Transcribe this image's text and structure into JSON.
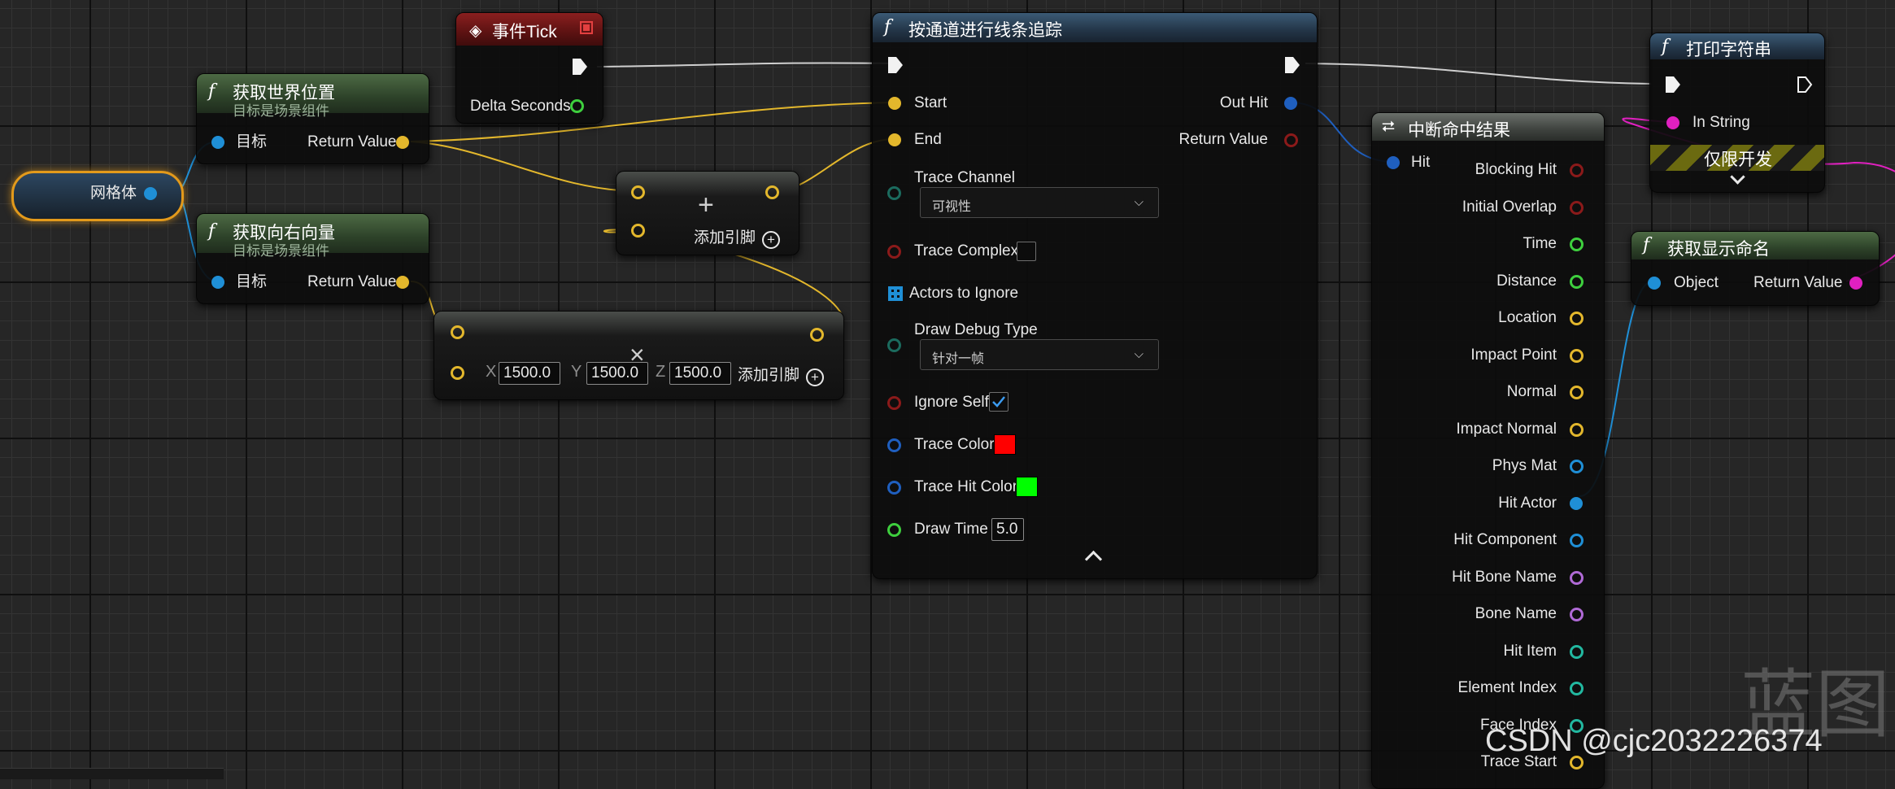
{
  "mesh_var": {
    "label": "网格体"
  },
  "event_tick": {
    "title": "事件Tick",
    "pin_delta": "Delta Seconds"
  },
  "get_world_location": {
    "title": "获取世界位置",
    "subtitle": "目标是场景组件",
    "pin_target": "目标",
    "pin_return": "Return Value"
  },
  "get_right_vector": {
    "title": "获取向右向量",
    "subtitle": "目标是场景组件",
    "pin_target": "目标",
    "pin_return": "Return Value"
  },
  "add_node": {
    "symbol": "+",
    "add_pin_label": "添加引脚"
  },
  "multiply_node": {
    "symbol": "×",
    "x_label": "X",
    "x_value": "1500.0",
    "y_label": "Y",
    "y_value": "1500.0",
    "z_label": "Z",
    "z_value": "1500.0",
    "add_pin_label": "添加引脚"
  },
  "line_trace": {
    "title": "按通道进行线条追踪",
    "pin_start": "Start",
    "pin_end": "End",
    "pin_trace_channel": "Trace Channel",
    "trace_channel_value": "可视性",
    "pin_trace_complex": "Trace Complex",
    "pin_actors_to_ignore": "Actors to Ignore",
    "pin_draw_debug_type": "Draw Debug Type",
    "draw_debug_type_value": "针对一帧",
    "pin_ignore_self": "Ignore Self",
    "pin_trace_color": "Trace Color",
    "pin_trace_hit_color": "Trace Hit Color",
    "pin_draw_time": "Draw Time",
    "draw_time_value": "5.0",
    "pin_out_hit": "Out Hit",
    "pin_return_value": "Return Value",
    "trace_complex_checked": false,
    "ignore_self_checked": true,
    "trace_color": "#ff0000",
    "trace_hit_color": "#00ff00"
  },
  "break_hit": {
    "title": "中断命中结果",
    "pin_hit": "Hit",
    "outputs": [
      {
        "label": "Blocking Hit",
        "color": "#8b1a1a"
      },
      {
        "label": "Initial Overlap",
        "color": "#8b1a1a"
      },
      {
        "label": "Time",
        "color": "#3ecf3e"
      },
      {
        "label": "Distance",
        "color": "#3ecf3e"
      },
      {
        "label": "Location",
        "color": "#e3b72c"
      },
      {
        "label": "Impact Point",
        "color": "#e3b72c"
      },
      {
        "label": "Normal",
        "color": "#e3b72c"
      },
      {
        "label": "Impact Normal",
        "color": "#e3b72c"
      },
      {
        "label": "Phys Mat",
        "color": "#1f8fd6"
      },
      {
        "label": "Hit Actor",
        "color": "#1f8fd6"
      },
      {
        "label": "Hit Component",
        "color": "#1f8fd6"
      },
      {
        "label": "Hit Bone Name",
        "color": "#b06ad6"
      },
      {
        "label": "Bone Name",
        "color": "#b06ad6"
      },
      {
        "label": "Hit Item",
        "color": "#22b8a0"
      },
      {
        "label": "Element Index",
        "color": "#22b8a0"
      },
      {
        "label": "Face Index",
        "color": "#22b8a0"
      },
      {
        "label": "Trace Start",
        "color": "#e3b72c"
      }
    ]
  },
  "print_string": {
    "title": "打印字符串",
    "pin_in_string": "In String",
    "dev_only_label": "仅限开发"
  },
  "get_display_name": {
    "title": "获取显示命名",
    "pin_object": "Object",
    "pin_return": "Return Value"
  },
  "watermark": {
    "big": "蓝图",
    "small": "CSDN @cjc2032226374"
  }
}
